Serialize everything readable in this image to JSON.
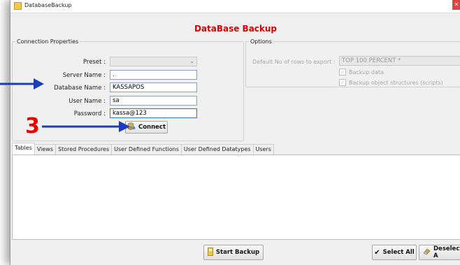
{
  "window": {
    "title": "DatabaseBackup",
    "heading": "DataBase Backup",
    "close_glyph": "✕"
  },
  "connection": {
    "legend": "Connection Properties",
    "preset_label": "Preset :",
    "preset_value": "",
    "server_label": "Server Name :",
    "server_value": ".",
    "database_label": "Database Name :",
    "database_value": "KASSAPOS",
    "user_label": "User Name :",
    "user_value": "sa",
    "password_label": "Password :",
    "password_value": "kassa@123",
    "connect_label": "Connect"
  },
  "options": {
    "legend": "Options",
    "rows_label": "Default No of rows to export :",
    "rows_value": "TOP 100 PERCENT *",
    "backup_data_label": "Backup data",
    "backup_structures_label": "Backup object structures (scripts)"
  },
  "tabs": [
    "Tables",
    "Views",
    "Stored Procedures",
    "User Defined Functions",
    "User Defined Datatypes",
    "Users"
  ],
  "bottom": {
    "start_backup_label": "Start Backup",
    "select_all_label": "Select All",
    "deselect_all_label": "Deselect A"
  },
  "annotation": {
    "step_number": "3",
    "arrow_color": "#1a3fb5",
    "number_color": "#e60000"
  },
  "colors": {
    "heading": "#d40000"
  }
}
